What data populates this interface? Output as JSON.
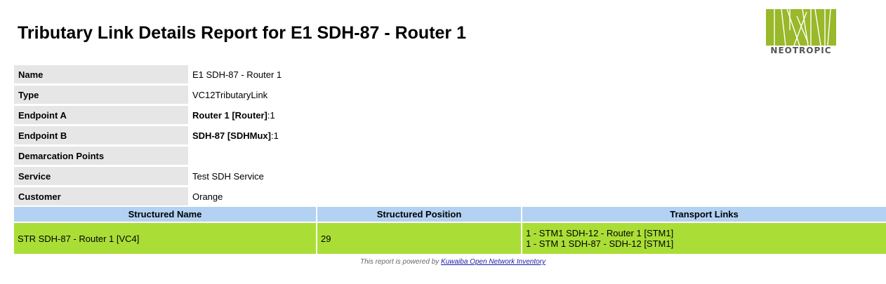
{
  "title": "Tributary Link Details Report for E1 SDH-87 - Router 1",
  "logo": {
    "text": "NEOTROPIC",
    "color": "#99b82a"
  },
  "details": [
    {
      "label": "Name",
      "value": "E1 SDH-87 - Router 1"
    },
    {
      "label": "Type",
      "value": "VC12TributaryLink"
    },
    {
      "label": "Endpoint A",
      "value_bold": "Router 1 [Router]",
      "value_rest": ":1"
    },
    {
      "label": "Endpoint B",
      "value_bold": "SDH-87 [SDHMux]",
      "value_rest": ":1"
    },
    {
      "label": "Demarcation Points",
      "value": ""
    },
    {
      "label": "Service",
      "value": "Test SDH Service"
    },
    {
      "label": "Customer",
      "value": "Orange"
    }
  ],
  "links_table": {
    "headers": [
      "Structured Name",
      "Structured Position",
      "Transport Links"
    ],
    "rows": [
      {
        "structured_name": "STR SDH-87 - Router 1 [VC4]",
        "structured_position": "29",
        "transport_links": [
          "1 - STM1 SDH-12 - Router 1 [STM1]",
          "1 - STM 1 SDH-87 - SDH-12 [STM1]"
        ]
      }
    ]
  },
  "footer": {
    "prefix": "This report is powered by ",
    "link_text": "Kuwaiba Open Network Inventory"
  }
}
